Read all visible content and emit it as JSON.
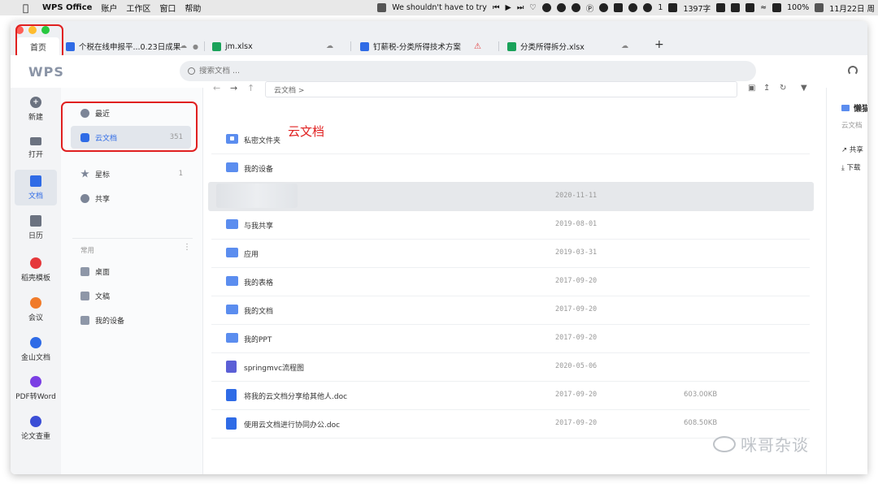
{
  "menubar": {
    "app_name": "WPS Office",
    "menus": [
      "账户",
      "工作区",
      "窗口",
      "帮助"
    ],
    "notice": "We shouldn't have to try",
    "badge_count": "1",
    "word_count": "1397字",
    "battery": "100%",
    "date": "11月22日 周"
  },
  "tabs": {
    "home": "首页",
    "items": [
      {
        "label": "个税在线申报平...0.23日成果",
        "type": "w"
      },
      {
        "label": "jm.xlsx",
        "type": "s"
      },
      {
        "label": "钉薪税-分类所得技术方案",
        "type": "w"
      },
      {
        "label": "分类所得拆分.xlsx",
        "type": "s"
      }
    ],
    "add": "+"
  },
  "header": {
    "logo": "WPS",
    "search_placeholder": "搜索文档 ..."
  },
  "rail": [
    {
      "label": "新建",
      "icon": "plus-icon"
    },
    {
      "label": "打开",
      "icon": "folder-icon"
    },
    {
      "label": "文档",
      "icon": "document-icon"
    },
    {
      "label": "日历",
      "icon": "calendar-icon"
    },
    {
      "label": "稻壳模板",
      "icon": "template-icon"
    },
    {
      "label": "会议",
      "icon": "meeting-icon"
    },
    {
      "label": "金山文档",
      "icon": "kdocs-icon"
    },
    {
      "label": "PDF转Word",
      "icon": "pdf-icon"
    },
    {
      "label": "论文查重",
      "icon": "check-icon"
    }
  ],
  "nav": {
    "recent": "最近",
    "cloud": "云文档",
    "cloud_count": "351",
    "starred": "星标",
    "starred_count": "1",
    "shared": "共享",
    "section": "常用",
    "desktop": "桌面",
    "docs": "文稿",
    "my_devices": "我的设备"
  },
  "toolbar": {
    "breadcrumb": "云文档  >"
  },
  "annotation": "云文档",
  "files": [
    {
      "name": "私密文件夹",
      "date": "",
      "size": ""
    },
    {
      "name": "我的设备",
      "date": "",
      "size": ""
    },
    {
      "name": "",
      "date": "2020-11-11",
      "size": ""
    },
    {
      "name": "与我共享",
      "date": "2019-08-01",
      "size": ""
    },
    {
      "name": "应用",
      "date": "2019-03-31",
      "size": ""
    },
    {
      "name": "我的表格",
      "date": "2017-09-20",
      "size": ""
    },
    {
      "name": "我的文档",
      "date": "2017-09-20",
      "size": ""
    },
    {
      "name": "我的PPT",
      "date": "2017-09-20",
      "size": ""
    },
    {
      "name": "springmvc流程图",
      "date": "2020-05-06",
      "size": ""
    },
    {
      "name": "将我的云文档分享给其他人.doc",
      "date": "2017-09-20",
      "size": "603.00KB"
    },
    {
      "name": "使用云文档进行协同办公.doc",
      "date": "2017-09-20",
      "size": "608.50KB"
    }
  ],
  "right_panel": {
    "title": "懒猫",
    "subtitle": "云文档",
    "share": "共享",
    "download": "下载"
  },
  "watermark": "咪哥杂谈"
}
